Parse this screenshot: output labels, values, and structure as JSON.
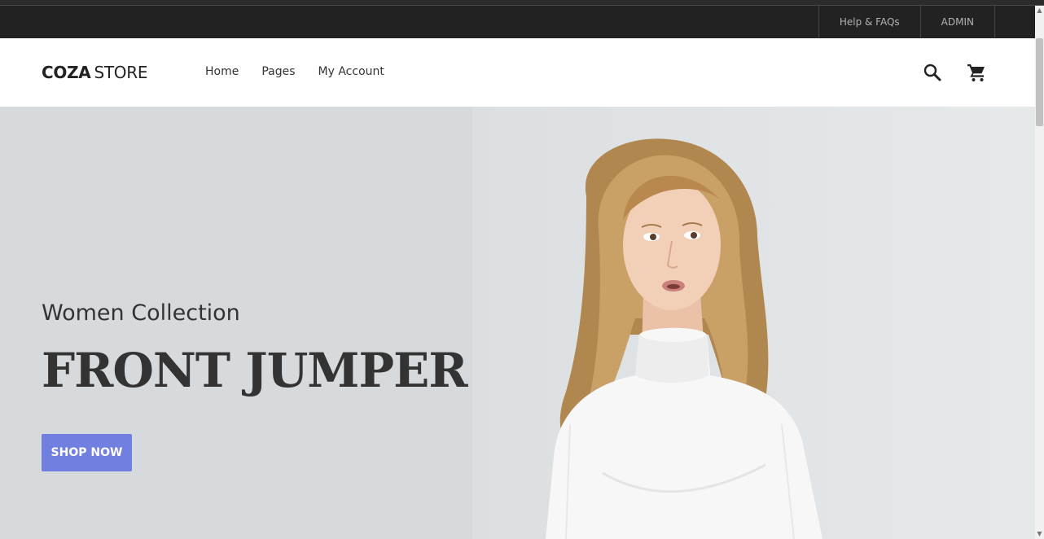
{
  "topbar": {
    "links": [
      "Help & FAQs",
      "ADMIN"
    ]
  },
  "header": {
    "logo_bold": "COZA",
    "logo_light": "STORE",
    "nav": [
      "Home",
      "Pages",
      "My Account"
    ],
    "icons": [
      "search-icon",
      "cart-icon"
    ]
  },
  "hero": {
    "subtitle": "Women Collection",
    "title": "FRONT JUMPER",
    "button": "SHOP NOW",
    "image": "woman in white turtleneck sweater"
  },
  "colors": {
    "topbar_bg": "#222222",
    "accent": "#717fe0",
    "hero_bg": "#d6dadc",
    "text_dark": "#333333"
  }
}
